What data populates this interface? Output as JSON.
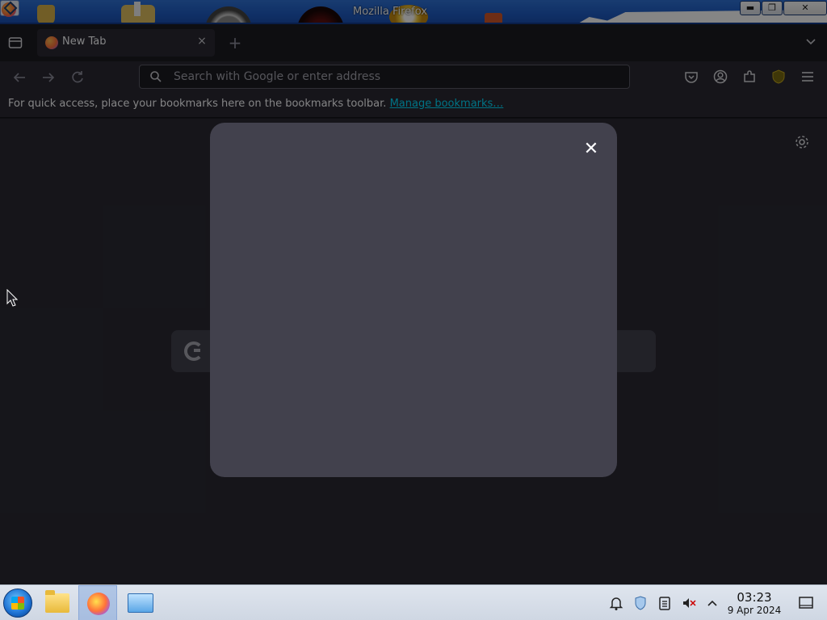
{
  "window": {
    "title": "Mozilla Firefox",
    "min_label": "▬",
    "max_label": "❐",
    "close_label": "✕"
  },
  "tabs": [
    {
      "title": "New Tab",
      "close_label": "×"
    }
  ],
  "newtab_label": "+",
  "urlbar": {
    "placeholder": "Search with Google or enter address"
  },
  "bookmarks": {
    "hint": "For quick access, place your bookmarks here on the bookmarks toolbar.",
    "link": "Manage bookmarks…"
  },
  "modal": {
    "close_label": "✕"
  },
  "taskbar": {
    "time": "03:23",
    "date": "9 Apr 2024"
  },
  "colors": {
    "accent_link": "#00ddff",
    "page_bg": "#2b2a33",
    "modal_bg": "#42414d",
    "titlebar": "#1f5cc4"
  }
}
